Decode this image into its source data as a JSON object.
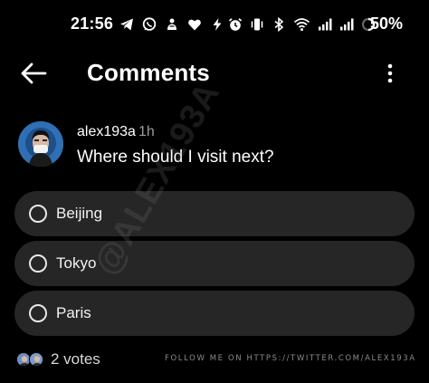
{
  "status_bar": {
    "time": "21:56",
    "battery": "50%",
    "left_icons": [
      "telegram-icon",
      "whatsapp-icon",
      "app-icon",
      "heart-icon",
      "bolt-icon"
    ],
    "right_icons": [
      "alarm-icon",
      "vibrate-icon",
      "bluetooth-icon",
      "wifi-icon",
      "signal-icon",
      "signal-icon",
      "battery-icon"
    ]
  },
  "header": {
    "title": "Comments"
  },
  "post": {
    "username": "alex193a",
    "time": "1h",
    "question": "Where should I visit next?"
  },
  "poll": {
    "options": [
      {
        "label": "Beijing"
      },
      {
        "label": "Tokyo"
      },
      {
        "label": "Paris"
      }
    ]
  },
  "footer": {
    "votes": "2 votes",
    "follow": "FOLLOW ME ON HTTPS://TWITTER.COM/ALEX193A"
  },
  "watermark": "@ALEX193A",
  "colors": {
    "background": "#000000",
    "option_bg": "#262626",
    "muted": "#9a9a9a"
  }
}
